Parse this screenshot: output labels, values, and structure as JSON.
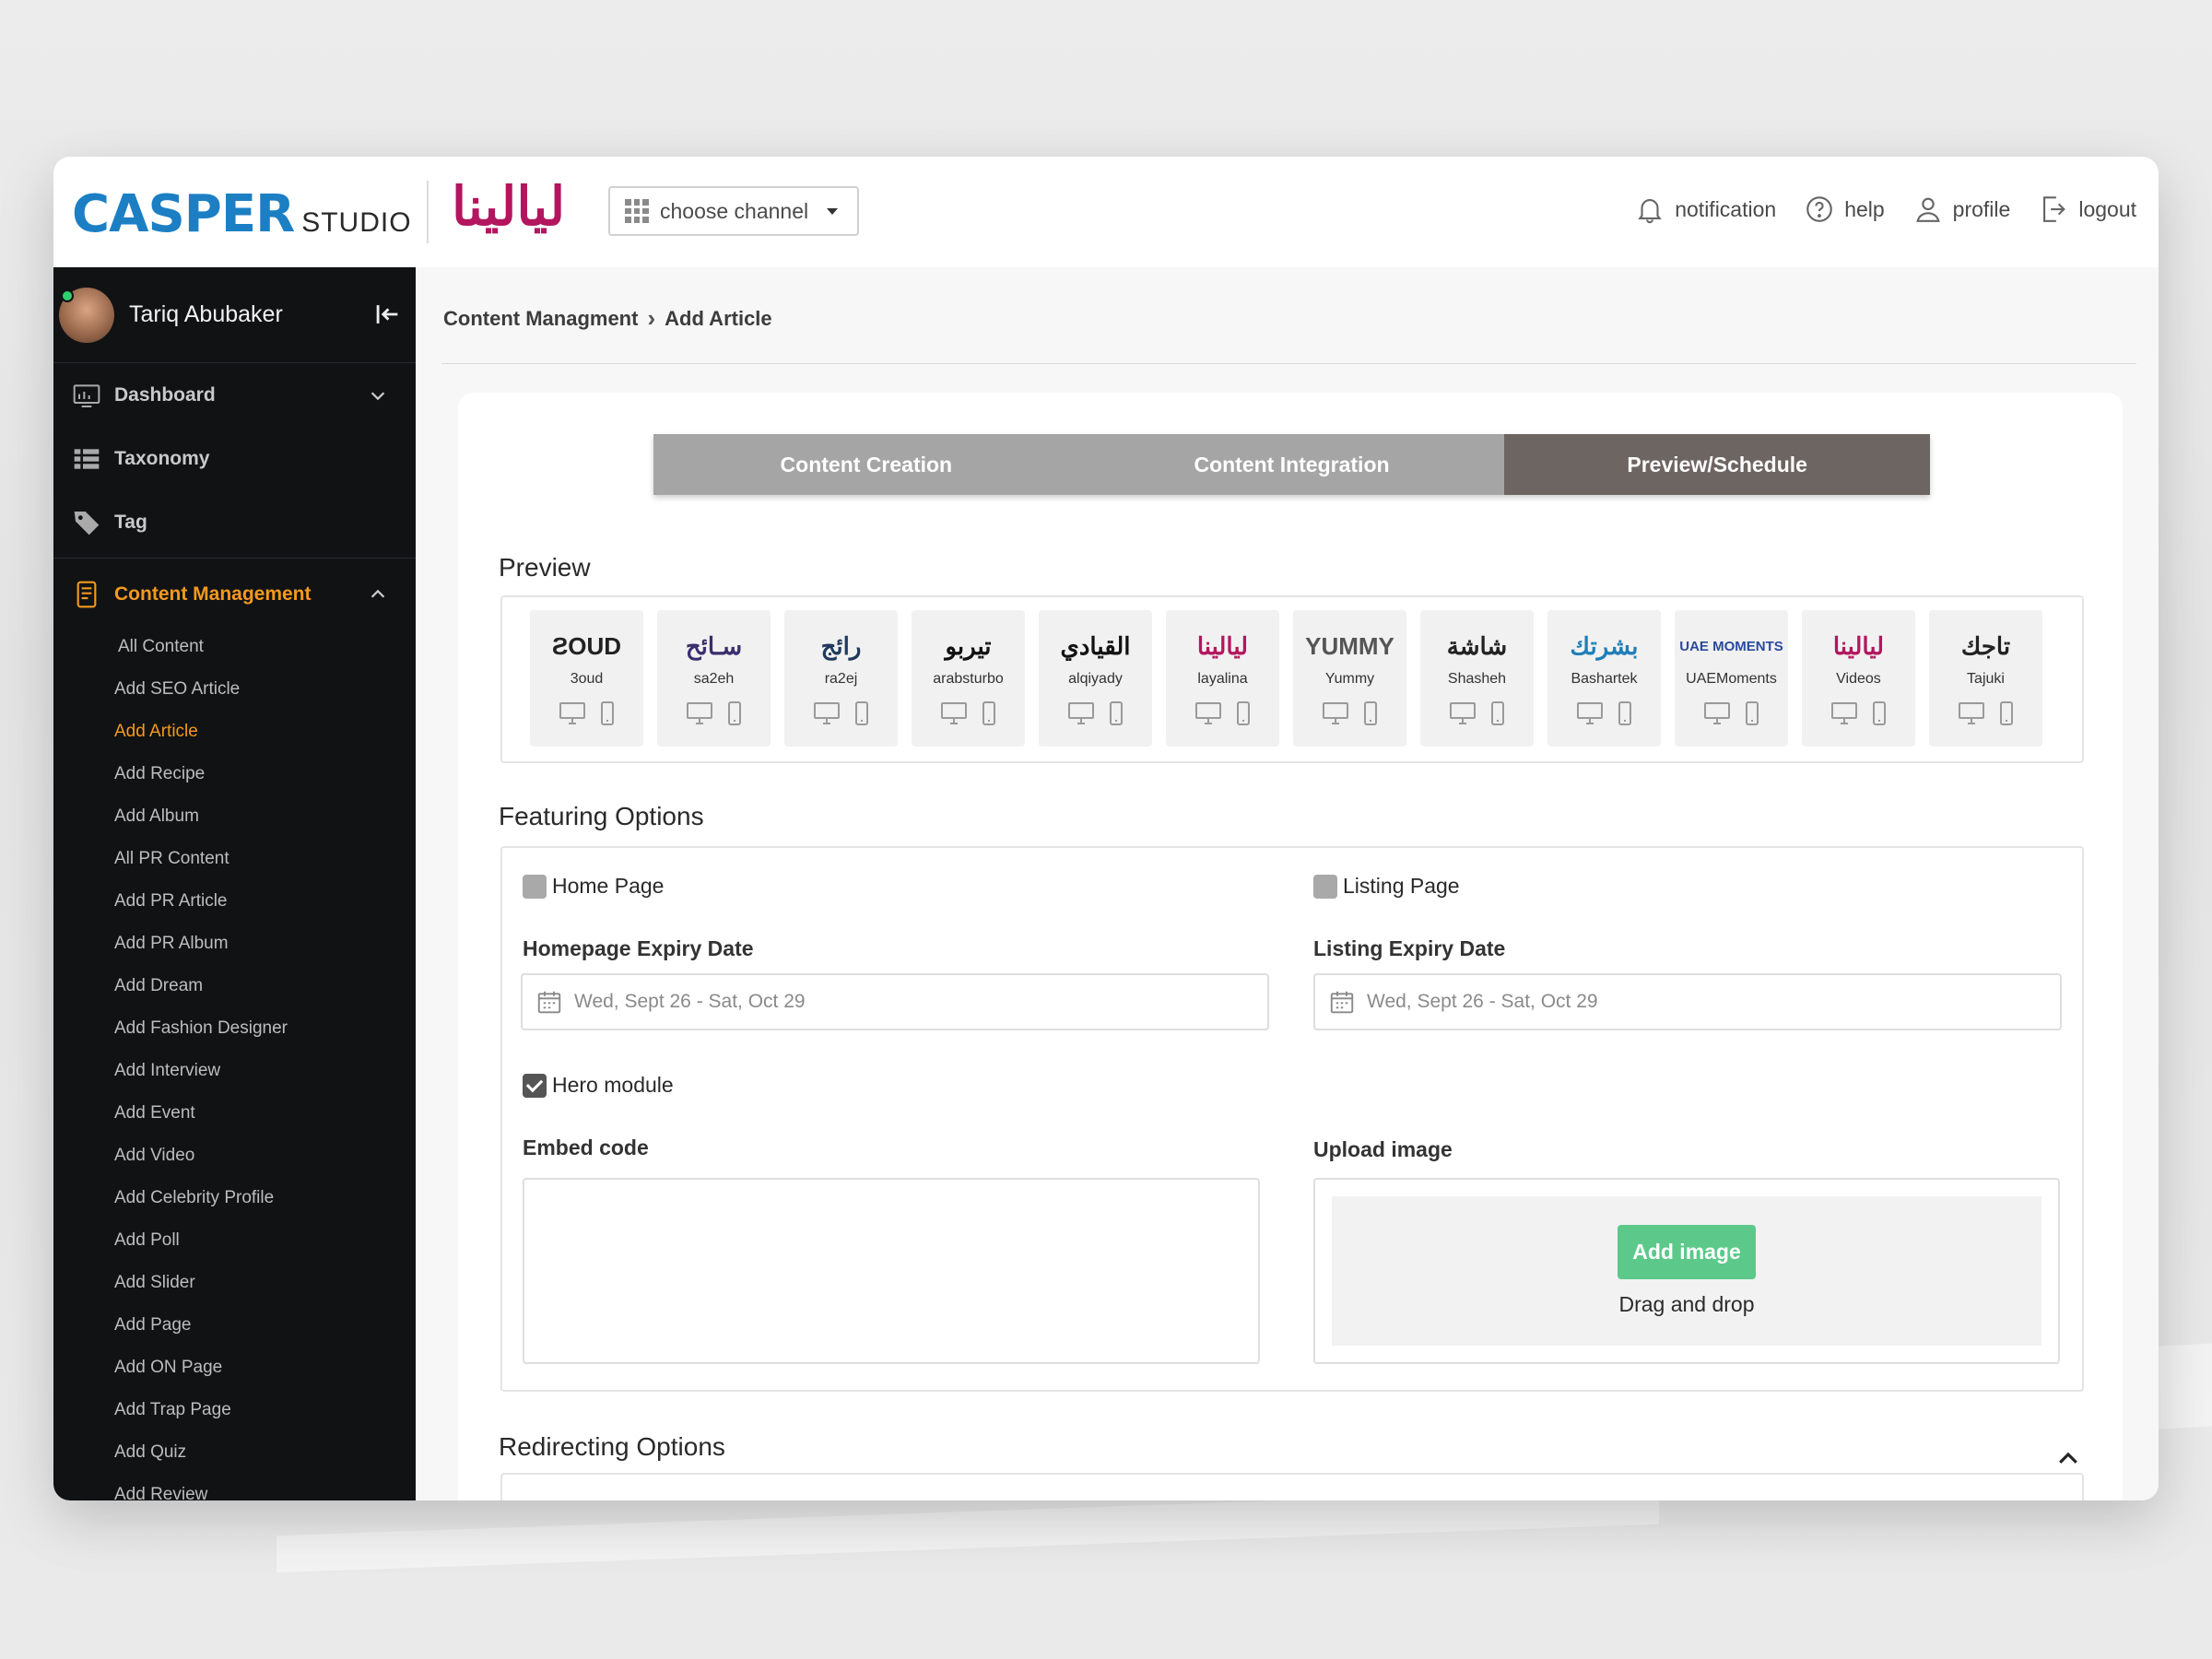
{
  "header": {
    "brand_main": "CASPER",
    "brand_sub": "STUDIO",
    "channel_logo": "ليالينا",
    "channel_select": "choose channel",
    "actions": {
      "notification": "notification",
      "help": "help",
      "profile": "profile",
      "logout": "logout"
    }
  },
  "sidebar": {
    "user_name": "Tariq Abubaker",
    "nav": {
      "dashboard": "Dashboard",
      "taxonomy": "Taxonomy",
      "tag": "Tag",
      "content_management": "Content Management"
    },
    "sub_items": [
      "All Content",
      "Add SEO Article",
      "Add Article",
      "Add Recipe",
      "Add Album",
      "All PR Content",
      "Add PR Article",
      "Add PR Album",
      "Add Dream",
      "Add Fashion Designer",
      "Add Interview",
      "Add Event",
      "Add Video",
      "Add Celebrity Profile",
      "Add Poll",
      "Add Slider",
      "Add Page",
      "Add ON Page",
      "Add Trap Page",
      "Add Quiz",
      "Add Review"
    ],
    "active_sub": "Add Article"
  },
  "breadcrumb": {
    "parent": "Content Managment",
    "current": "Add Article"
  },
  "tabs": [
    "Content Creation",
    "Content Integration",
    "Preview/Schedule"
  ],
  "active_tab": "Preview/Schedule",
  "preview": {
    "title": "Preview",
    "sites": [
      {
        "logo": "ƧOUD",
        "name": "3oud",
        "color": "#222222"
      },
      {
        "logo": "سـائح",
        "name": "sa2eh",
        "color": "#3a2e6e"
      },
      {
        "logo": "رائج",
        "name": "ra2ej",
        "color": "#1f3a5c"
      },
      {
        "logo": "تيربو",
        "name": "arabsturbo",
        "color": "#111111"
      },
      {
        "logo": "القيادي",
        "name": "alqiyady",
        "color": "#111111"
      },
      {
        "logo": "ليالينا",
        "name": "layalina",
        "color": "#b3165e"
      },
      {
        "logo": "YUMMY",
        "name": "Yummy",
        "color": "#555555"
      },
      {
        "logo": "شاشة",
        "name": "Shasheh",
        "color": "#222222"
      },
      {
        "logo": "بشرتك",
        "name": "Bashartek",
        "color": "#1f7fb8"
      },
      {
        "logo": "UAE MOMENTS",
        "name": "UAEMoments",
        "color": "#2a4a9c"
      },
      {
        "logo": "ليالينا",
        "name": "Videos",
        "color": "#b3165e"
      },
      {
        "logo": "تاجك",
        "name": "Tajuki",
        "color": "#222222"
      }
    ]
  },
  "featuring": {
    "title": "Featuring Options",
    "home_page": {
      "label": "Home Page",
      "checked": false
    },
    "listing_page": {
      "label": "Listing Page",
      "checked": false
    },
    "homepage_expiry_label": "Homepage Expiry Date",
    "homepage_expiry_value": "Wed, Sept 26 - Sat, Oct 29",
    "listing_expiry_label": "Listing Expiry Date",
    "listing_expiry_value": "Wed, Sept 26 - Sat, Oct 29",
    "hero_module": {
      "label": "Hero module",
      "checked": true
    },
    "embed_label": "Embed code",
    "upload_label": "Upload image",
    "add_image_button": "Add image",
    "drag_drop": "Drag and drop"
  },
  "redirecting": {
    "title": "Redirecting Options"
  },
  "colors": {
    "brand_blue": "#1c7fc4",
    "accent_orange": "#f39a1e",
    "active_tab": "#6d6561",
    "add_image_green": "#5cc98a"
  }
}
